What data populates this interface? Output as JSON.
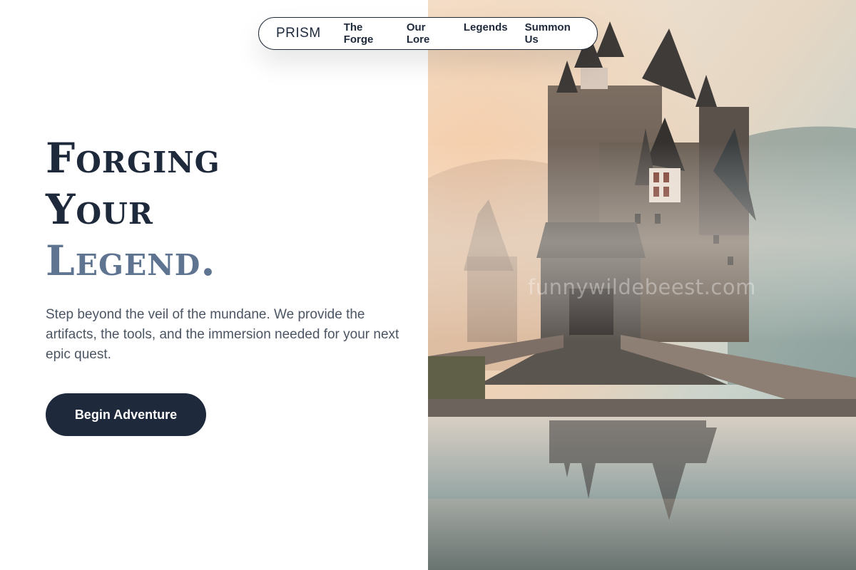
{
  "nav": {
    "brand": "PRISM",
    "links": [
      {
        "label": "The Forge"
      },
      {
        "label": "Our Lore"
      },
      {
        "label": "Legends"
      },
      {
        "label": "Summon Us"
      }
    ]
  },
  "hero": {
    "headline": {
      "line1": "Forging",
      "line2": "Your",
      "line3": "Legend."
    },
    "description": "Step beyond the veil of the mundane. We provide the artifacts, the tools, and the immersion needed for your next epic quest.",
    "cta_label": "Begin Adventure",
    "image_subject": "misty castle with stone bridge reflected in water"
  },
  "watermark": "funnywildebeest.com",
  "colors": {
    "primary": "#1e293b",
    "accent": "#5f7490",
    "body_text": "#4b5563",
    "background": "#ffffff"
  }
}
